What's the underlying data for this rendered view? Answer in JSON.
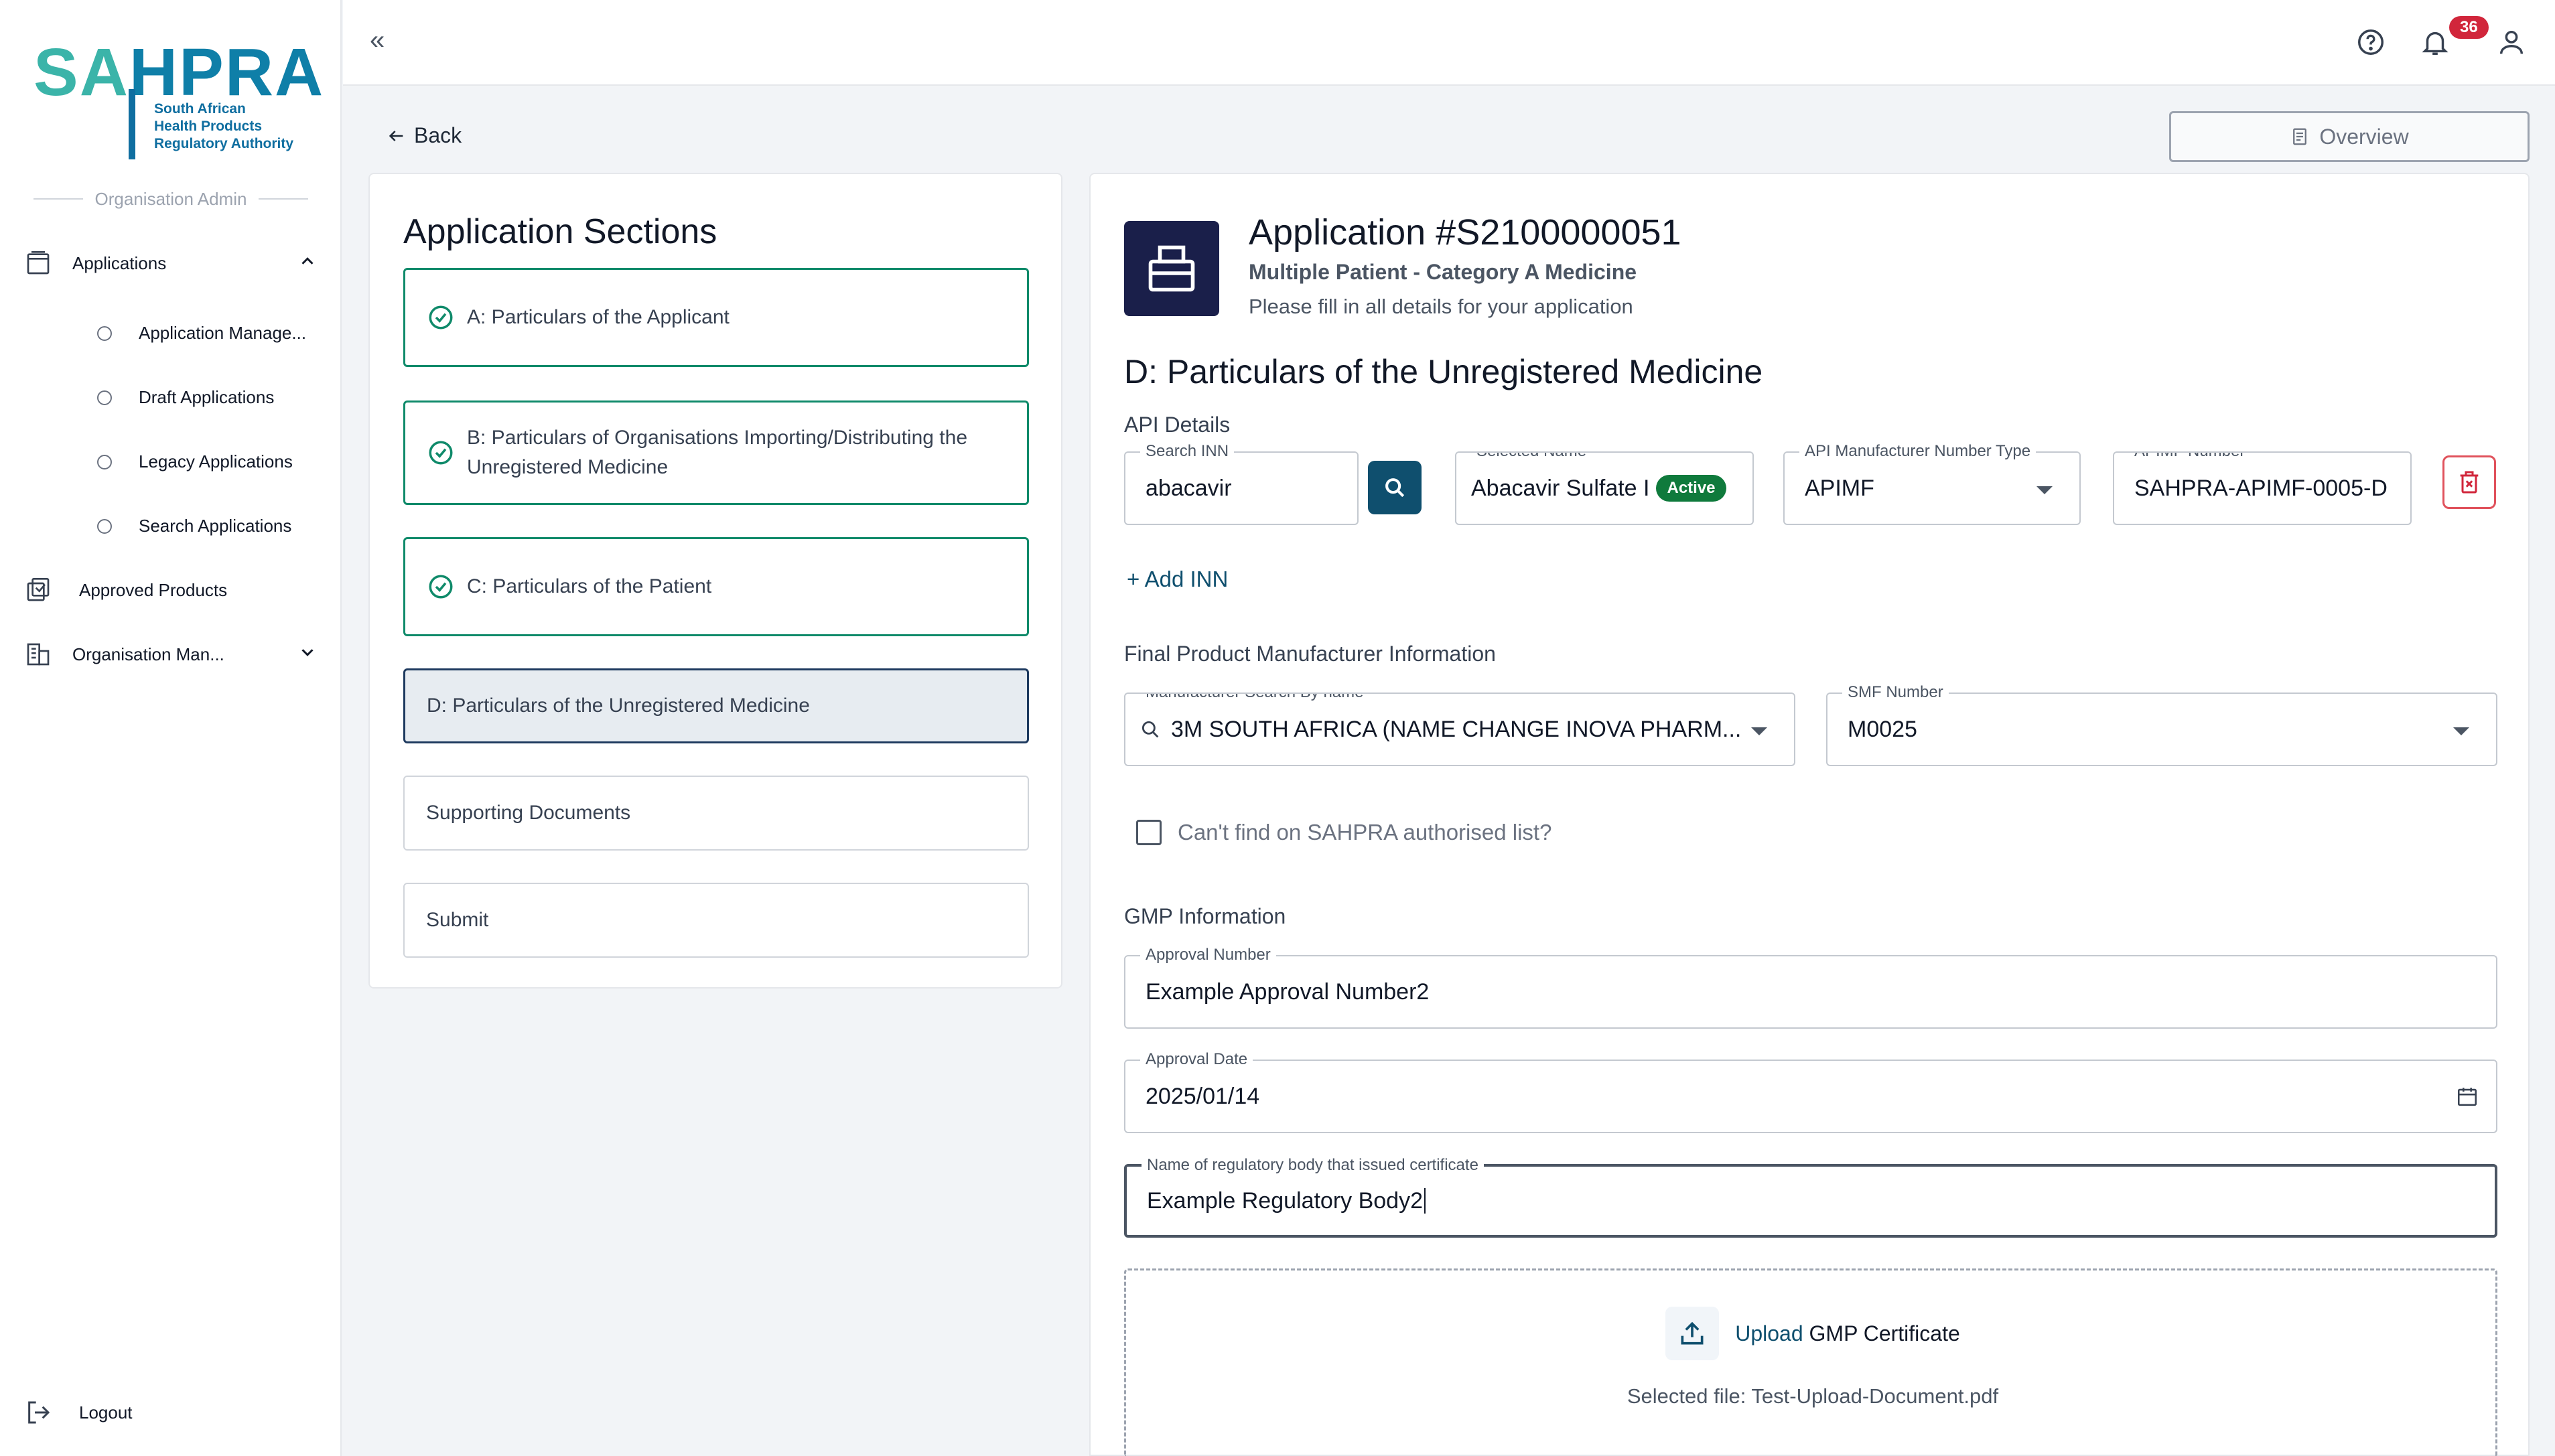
{
  "logo": {
    "sa": "SA",
    "hpra": "HPRA",
    "line1": "South African",
    "line2": "Health Products",
    "line3": "Regulatory Authority"
  },
  "sidebar": {
    "role": "Organisation Admin",
    "applications": "Applications",
    "sub_items": [
      "Application Manage...",
      "Draft Applications",
      "Legacy Applications",
      "Search Applications"
    ],
    "approved_products": "Approved Products",
    "organisation": "Organisation Man...",
    "logout": "Logout"
  },
  "topbar": {
    "collapse_glyph": "«",
    "notification_count": "36"
  },
  "nav": {
    "back": "Back",
    "overview": "Overview"
  },
  "sections_panel": {
    "title": "Application Sections",
    "items": [
      {
        "label": "A: Particulars of the Applicant",
        "status": "done"
      },
      {
        "label": "B: Particulars of Organisations Importing/Distributing the Unregistered Medicine",
        "status": "done"
      },
      {
        "label": "C: Particulars of the Patient",
        "status": "done"
      },
      {
        "label": "D: Particulars of the Unregistered Medicine",
        "status": "active"
      },
      {
        "label": "Supporting Documents",
        "status": "todo"
      },
      {
        "label": "Submit",
        "status": "todo"
      }
    ]
  },
  "application": {
    "title": "Application #S2100000051",
    "subtitle": "Multiple Patient - Category A Medicine",
    "hint": "Please fill in all details for your application"
  },
  "form": {
    "section_title": "D: Particulars of the Unregistered Medicine",
    "api_details_label": "API Details",
    "search_inn": {
      "label": "Search INN",
      "value": "abacavir"
    },
    "selected_name": {
      "label": "Selected Name",
      "value": "Abacavir Sulfate I",
      "status": "Active"
    },
    "api_type": {
      "label": "API Manufacturer Number Type",
      "value": "APIMF"
    },
    "apimf_number": {
      "label": "APIMF Number",
      "value": "SAHPRA-APIMF-0005-D"
    },
    "add_inn": "+ Add INN",
    "final_product_label": "Final Product Manufacturer Information",
    "manufacturer": {
      "label": "Manufacturer Search By name",
      "value": "3M SOUTH AFRICA (NAME CHANGE INOVA PHARM..."
    },
    "smf": {
      "label": "SMF Number",
      "value": "M0025"
    },
    "cant_find": "Can't find on SAHPRA authorised list?",
    "gmp_label": "GMP Information",
    "approval_number": {
      "label": "Approval Number",
      "value": "Example Approval Number2"
    },
    "approval_date": {
      "label": "Approval Date",
      "value": "2025/01/14"
    },
    "regulatory_body": {
      "label": "Name of regulatory body that issued certificate",
      "value": "Example Regulatory Body2"
    },
    "upload": {
      "link": "Upload",
      "text": "GMP Certificate",
      "selected": "Selected file: Test-Upload-Document.pdf"
    }
  },
  "colors": {
    "brand_teal": "#3bb4a9",
    "brand_blue": "#0f7fa8",
    "done_green": "#0f8a6a",
    "primary": "#0f4f6e",
    "danger": "#d1263b"
  }
}
